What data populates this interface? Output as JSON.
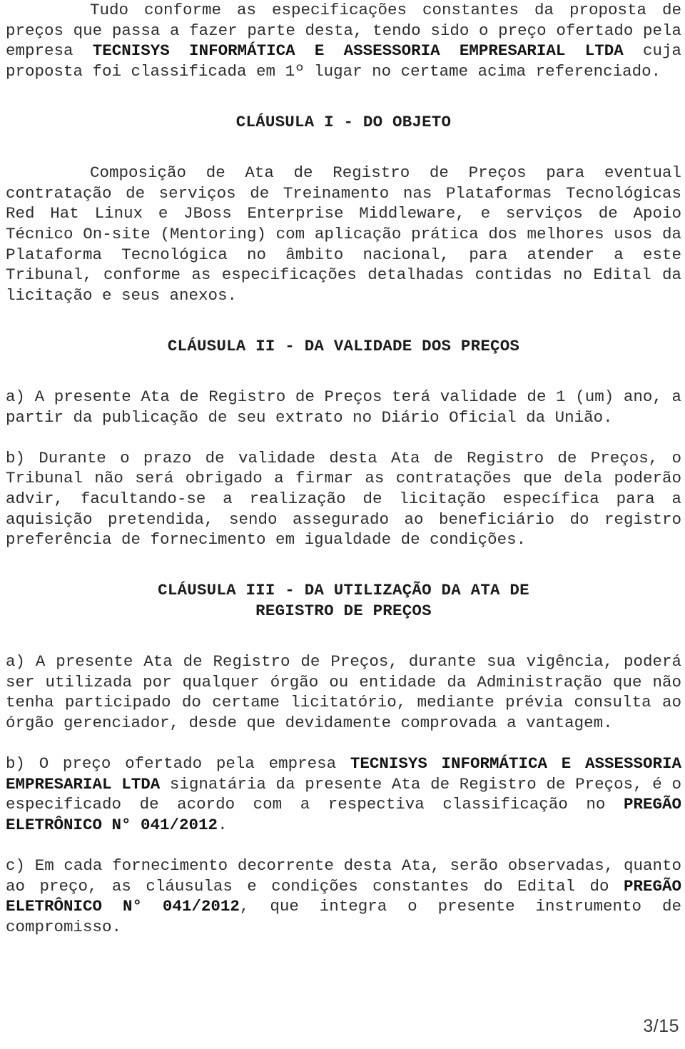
{
  "document": {
    "page_label": "3/15",
    "blocks": [
      {
        "id": "intro",
        "type": "paragraph",
        "indent": true,
        "runs": [
          {
            "text": "Tudo conforme as especificações constantes da proposta de preços que passa a fazer parte desta, tendo sido o preço ofertado pela empresa ",
            "bold": false
          },
          {
            "text": "TECNISYS INFORMÁTICA E ASSESSORIA EMPRESARIAL LTDA",
            "bold": true
          },
          {
            "text": " cuja proposta foi classificada em 1º lugar no certame acima referenciado.",
            "bold": false
          }
        ]
      },
      {
        "id": "heading-clausula-1",
        "type": "heading",
        "lines": [
          "CLÁUSULA I - DO OBJETO"
        ]
      },
      {
        "id": "objeto",
        "type": "paragraph",
        "indent": true,
        "runs": [
          {
            "text": "Composição de Ata de Registro de Preços para eventual contratação de serviços de Treinamento nas Plataformas Tecnológicas  Red Hat Linux e JBoss Enterprise Middleware, e serviços de Apoio Técnico On-site (Mentoring) com aplicação prática dos melhores usos da Plataforma Tecnológica no âmbito nacional, para atender a este Tribunal, conforme as especificações detalhadas contidas no Edital da licitação e seus anexos.",
            "bold": false
          }
        ]
      },
      {
        "id": "heading-clausula-2",
        "type": "heading",
        "lines": [
          "CLÁUSULA II - DA VALIDADE DOS PREÇOS"
        ]
      },
      {
        "id": "clausula2-a",
        "type": "paragraph",
        "indent": false,
        "runs": [
          {
            "text": "a) A presente Ata de Registro de Preços terá validade de 1 (um) ano, a partir da publicação de seu extrato no Diário Oficial da União.",
            "bold": false
          }
        ]
      },
      {
        "id": "clausula2-b",
        "type": "paragraph",
        "indent": false,
        "runs": [
          {
            "text": "b) Durante o prazo de validade desta Ata de Registro de Preços, o Tribunal não será obrigado a firmar as contratações que dela poderão advir, facultando-se a realização de licitação específica para a aquisição pretendida, sendo assegurado ao beneficiário do registro preferência de fornecimento em igualdade de condições.",
            "bold": false
          }
        ]
      },
      {
        "id": "heading-clausula-3",
        "type": "heading",
        "lines": [
          "CLÁUSULA III - DA UTILIZAÇÃO DA ATA DE",
          "REGISTRO DE PREÇOS"
        ]
      },
      {
        "id": "clausula3-a",
        "type": "paragraph",
        "indent": false,
        "runs": [
          {
            "text": "a) A presente Ata de Registro de Preços, durante sua vigência, poderá ser utilizada por qualquer órgão ou entidade da Administração que não tenha participado do certame licitatório, mediante prévia consulta ao órgão gerenciador, desde que devidamente comprovada a vantagem.",
            "bold": false
          }
        ]
      },
      {
        "id": "clausula3-b",
        "type": "paragraph",
        "indent": false,
        "runs": [
          {
            "text": "b) O preço ofertado pela empresa ",
            "bold": false
          },
          {
            "text": "TECNISYS INFORMÁTICA E ASSESSORIA EMPRESARIAL LTDA",
            "bold": true
          },
          {
            "text": " signatária da presente Ata de Registro de Preços, é o especificado de acordo com a respectiva classificação no ",
            "bold": false
          },
          {
            "text": "PREGÃO ELETRÔNICO N° 041/2012",
            "bold": true
          },
          {
            "text": ".",
            "bold": false
          }
        ]
      },
      {
        "id": "clausula3-c",
        "type": "paragraph",
        "indent": false,
        "runs": [
          {
            "text": "c) Em cada fornecimento decorrente desta Ata, serão observadas, quanto ao preço, as cláusulas e condições constantes do Edital do ",
            "bold": false
          },
          {
            "text": "PREGÃO ELETRÔNICO N° 041/2012",
            "bold": true
          },
          {
            "text": ", que integra o presente instrumento de compromisso.",
            "bold": false
          }
        ]
      }
    ]
  }
}
